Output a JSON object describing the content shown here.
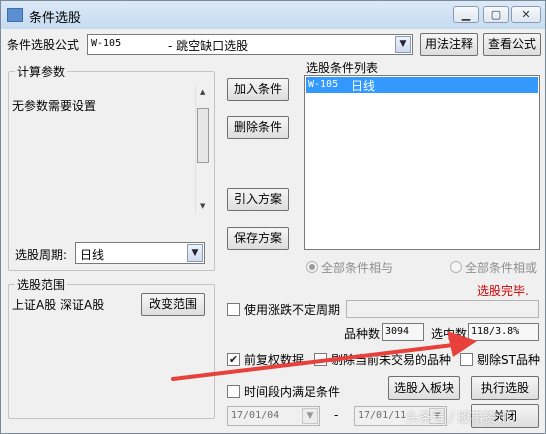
{
  "window": {
    "title": "条件选股"
  },
  "formula": {
    "label": "条件选股公式",
    "code": "W-105",
    "name": "- 跳空缺口选股",
    "usage_button": "用法注释",
    "view_button": "查看公式"
  },
  "params": {
    "group_label": "计算参数",
    "message": "无参数需要设置",
    "period_label": "选股周期:",
    "period_value": "日线"
  },
  "actions": {
    "add": "加入条件",
    "delete": "删除条件",
    "import": "引入方案",
    "save": "保存方案"
  },
  "condition_list": {
    "label": "选股条件列表",
    "items": [
      {
        "code": "W-105",
        "name": "日线"
      }
    ]
  },
  "logic": {
    "all_and": "全部条件相与",
    "all_or": "全部条件相或"
  },
  "status": {
    "text": "选股完毕.",
    "color": "#cc0000"
  },
  "scope": {
    "group_label": "选股范围",
    "markets": "上证A股 深证A股",
    "change_button": "改变范围"
  },
  "options": {
    "variable_period": "使用涨跌不定周期",
    "forward_adjust": "前复权数据",
    "remove_untraded": "剔除当前未交易的品种",
    "remove_st": "剔除ST品种",
    "time_range": "时间段内满足条件"
  },
  "stats": {
    "count_label": "品种数",
    "count_value": "3094",
    "selected_label": "选中数",
    "selected_value": "118/3.8%"
  },
  "bottom": {
    "to_block_button": "选股入板块",
    "execute_button": "执行选股",
    "start_date": "17/01/04",
    "dash": "-",
    "end_date": "17/01/11",
    "close_button": "关闭"
  },
  "watermark": {
    "text": "头条号 / 股事资讯"
  },
  "colors": {
    "accent": "#3399ff",
    "status": "#cc0000",
    "arrow": "#e8403a"
  }
}
